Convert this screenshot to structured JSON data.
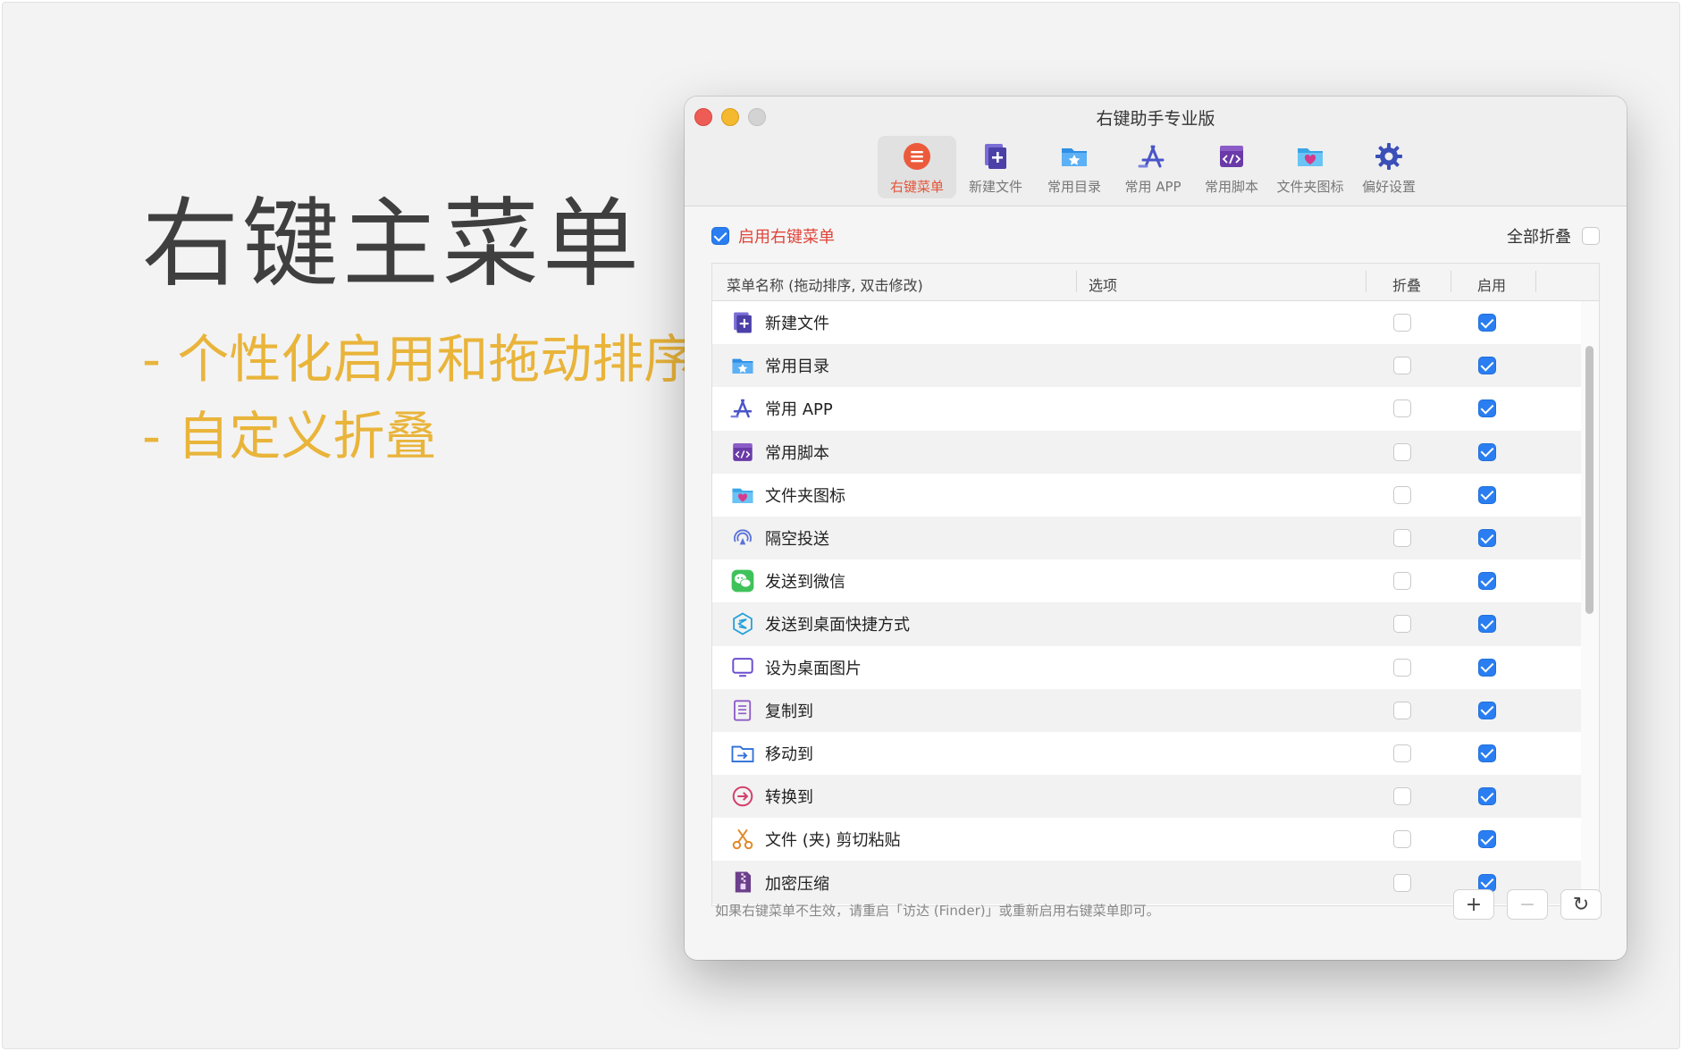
{
  "slide": {
    "title": "右键主菜单",
    "features": [
      "- 个性化启用和拖动排序",
      "- 自定义折叠"
    ]
  },
  "window": {
    "title": "右键助手专业版",
    "toolbar": [
      {
        "label": "右键菜单",
        "icon": "context-menu-icon",
        "active": true
      },
      {
        "label": "新建文件",
        "icon": "new-file-icon"
      },
      {
        "label": "常用目录",
        "icon": "favorite-folder-icon"
      },
      {
        "label": "常用 APP",
        "icon": "app-store-icon"
      },
      {
        "label": "常用脚本",
        "icon": "script-icon"
      },
      {
        "label": "文件夹图标",
        "icon": "folder-heart-icon"
      },
      {
        "label": "偏好设置",
        "icon": "gear-icon"
      }
    ],
    "enable_label": "启用右键菜单",
    "enable_checked": true,
    "collapse_all_label": "全部折叠",
    "collapse_all_checked": false,
    "table": {
      "headers": {
        "name": "菜单名称 (拖动排序, 双击修改)",
        "options": "选项",
        "fold": "折叠",
        "enable": "启用"
      },
      "rows": [
        {
          "name": "新建文件",
          "icon": "new-file-icon",
          "fold": false,
          "enabled": true
        },
        {
          "name": "常用目录",
          "icon": "favorite-folder-icon",
          "fold": false,
          "enabled": true
        },
        {
          "name": "常用 APP",
          "icon": "app-store-icon",
          "fold": false,
          "enabled": true
        },
        {
          "name": "常用脚本",
          "icon": "script-icon",
          "fold": false,
          "enabled": true
        },
        {
          "name": "文件夹图标",
          "icon": "folder-heart-icon",
          "fold": false,
          "enabled": true
        },
        {
          "name": "隔空投送",
          "icon": "airdrop-icon",
          "fold": false,
          "enabled": true
        },
        {
          "name": "发送到微信",
          "icon": "wechat-icon",
          "fold": false,
          "enabled": true
        },
        {
          "name": "发送到桌面快捷方式",
          "icon": "shortcut-icon",
          "fold": false,
          "enabled": true
        },
        {
          "name": "设为桌面图片",
          "icon": "monitor-icon",
          "fold": false,
          "enabled": true
        },
        {
          "name": "复制到",
          "icon": "copy-icon",
          "fold": false,
          "enabled": true
        },
        {
          "name": "移动到",
          "icon": "move-folder-icon",
          "fold": false,
          "enabled": true
        },
        {
          "name": "转换到",
          "icon": "convert-icon",
          "fold": false,
          "enabled": true
        },
        {
          "name": "文件 (夹) 剪切粘贴",
          "icon": "scissors-icon",
          "fold": false,
          "enabled": true
        },
        {
          "name": "加密压缩",
          "icon": "archive-icon",
          "fold": false,
          "enabled": true
        }
      ]
    },
    "footer_note": "如果右键菜单不生效，请重启「访达 (Finder)」或重新启用右键菜单即可。",
    "footer_buttons": {
      "add": "+",
      "remove": "−",
      "refresh": "↻"
    }
  },
  "colors": {
    "accent_red": "#e0453a",
    "check_blue": "#2a7ef1",
    "feature_yellow": "#e9b43a"
  }
}
